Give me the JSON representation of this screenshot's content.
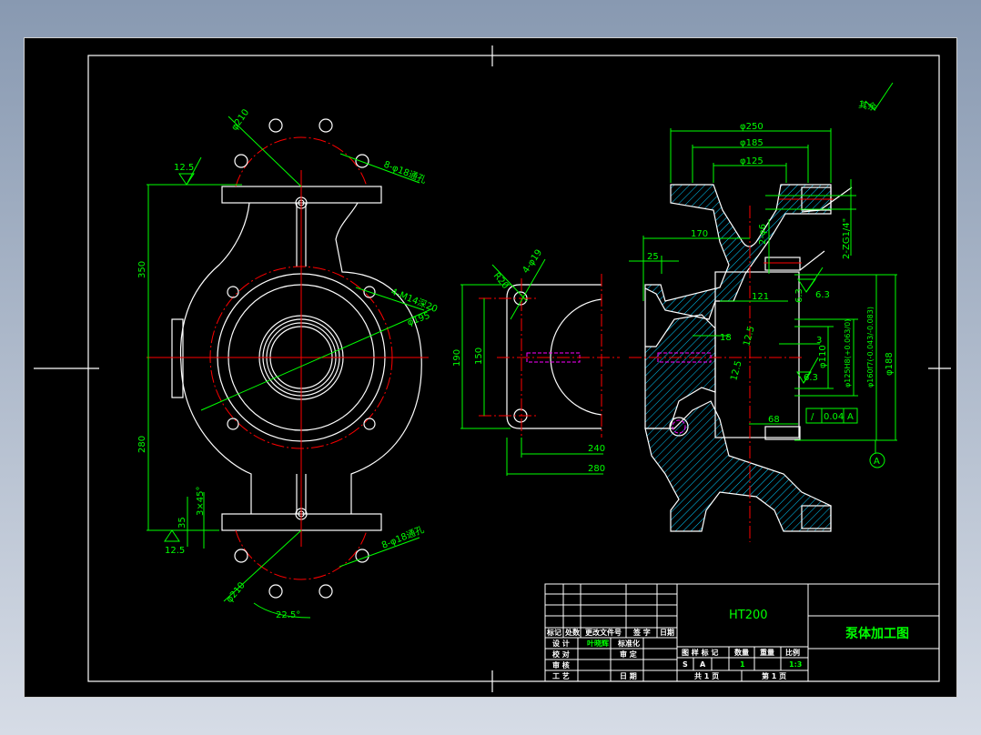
{
  "title_block": {
    "material": "HT200",
    "drawing_title": "泵体加工图",
    "headers": [
      "标记",
      "处数",
      "更改文件号",
      "签 字",
      "日期"
    ],
    "design_label": "设 计",
    "designer": "叶晓辉",
    "standardize_label": "标准化",
    "check_label": "校 对",
    "approve_label": "审 定",
    "review_label": "审 核",
    "process_label": "工 艺",
    "date_label": "日 期",
    "pattern_mark_label": "图 样 标 记",
    "quantity_label": "数量",
    "weight_label": "重量",
    "scale_label": "比例",
    "mark_s": "S",
    "mark_a": "A",
    "quantity": "1",
    "scale": "1:3",
    "total_pages": "共 1 页",
    "page_number": "第 1 页"
  },
  "front_view": {
    "dims": {
      "bolt_circle_top": "φ210",
      "roughness_top": "12.5",
      "holes_top": "8-φ18通孔",
      "height_upper": "350",
      "height_lower": "280",
      "tapped_holes": "4-M14深20",
      "pitch_circle": "φ195",
      "chamfer": "3×45°",
      "flange_thk": "35",
      "roughness_bottom": "12.5",
      "holes_bottom": "8-φ18通孔",
      "bolt_circle_bottom": "φ210",
      "angle": "22.5°"
    }
  },
  "side_view": {
    "dims": {
      "radius": "R20",
      "holes": "4-φ19",
      "height_outer": "190",
      "height_inner": "150",
      "width_inner": "240",
      "width_outer": "280"
    }
  },
  "section_view": {
    "dims": {
      "d250": "φ250",
      "d185": "φ185",
      "d125": "φ125",
      "len170": "170",
      "len25": "25",
      "holes_2": "2-φ6",
      "pipe_thread": "2-ZG1/4\"",
      "len121": "121",
      "len18": "18",
      "rough_12_5a": "12.5",
      "rough_12_5b": "12.5",
      "len3": "3",
      "d110": "φ110",
      "rough_6_3a": "6.3",
      "rough_6_3b": "6.3",
      "rough_6_3c": "6.3",
      "bore": "φ125H8(+0.063/0)",
      "spigot": "φ160f7(-0.043/-0.083)",
      "d188": "φ188",
      "len68": "68",
      "tolerance_value": "0.04",
      "datum": "A",
      "datum_ref": "A",
      "other_surfaces": "其余"
    }
  }
}
